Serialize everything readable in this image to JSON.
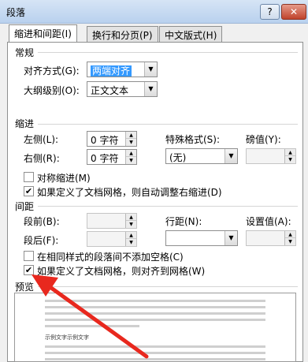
{
  "window": {
    "title": "段落",
    "help": "?",
    "close": "✕"
  },
  "tabs": [
    {
      "label": "缩进和间距(I)"
    },
    {
      "label": "换行和分页(P)"
    },
    {
      "label": "中文版式(H)"
    }
  ],
  "general": {
    "heading": "常规",
    "alignment_label": "对齐方式(G):",
    "alignment_value": "两端对齐",
    "outline_label": "大纲级别(O):",
    "outline_value": "正文文本"
  },
  "indent": {
    "heading": "缩进",
    "left_label": "左侧(L):",
    "left_value": "0 字符",
    "right_label": "右侧(R):",
    "right_value": "0 字符",
    "special_label": "特殊格式(S):",
    "special_value": "(无)",
    "by_label": "磅值(Y):",
    "mirror_label": "对称缩进(M)",
    "mirror_checked": false,
    "auto_adjust_label": "如果定义了文档网格，则自动调整右缩进(D)",
    "auto_adjust_checked": true
  },
  "spacing": {
    "heading": "间距",
    "before_label": "段前(B):",
    "after_label": "段后(F):",
    "line_spacing_label": "行距(N):",
    "at_label": "设置值(A):",
    "no_space_label": "在相同样式的段落间不添加空格(C)",
    "no_space_checked": false,
    "snap_grid_label": "如果定义了文档网格，则对齐到网格(W)",
    "snap_grid_checked": true
  },
  "preview": {
    "heading": "预览",
    "sample_text": "示例文字示例文字"
  },
  "colors": {
    "arrow": "#e8281e",
    "selection": "#3399ff"
  }
}
